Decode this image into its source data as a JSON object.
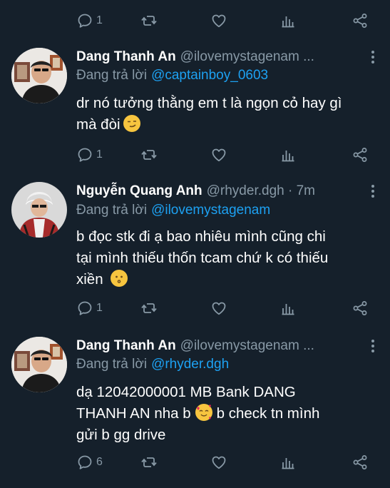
{
  "actions": {
    "top": {
      "reply_count": "1"
    }
  },
  "tweets": [
    {
      "author": "Dang Thanh An",
      "handle": "@ilovemystagenam ...",
      "replying_label": "Đang trả lời",
      "replying_to": "@captainboy_0603",
      "text_line1": "dr nó tưởng thằng em t là ngọn cỏ hay gì",
      "text_line2": "mà đòi",
      "emoji": "smirking-face",
      "reply_count": "1"
    },
    {
      "author": "Nguyễn Quang Anh",
      "handle": "@rhyder.dgh · 7m",
      "replying_label": "Đang trả lời",
      "replying_to": "@ilovemystagenam",
      "text_line1": "b đọc stk đi ạ bao nhiêu mình cũng chi",
      "text_line2": "tại mình thiếu thốn tcam chứ k có thiếu",
      "text_line3": "xiền",
      "emoji": "kissing-face",
      "reply_count": "1"
    },
    {
      "author": "Dang Thanh An",
      "handle": "@ilovemystagenam ...",
      "replying_label": "Đang trả lời",
      "replying_to": "@rhyder.dgh",
      "text_line1": "dạ 12042000001 MB Bank DANG",
      "text_line2a": "THANH AN nha b",
      "text_line2b": "b check tn mình",
      "text_line3": "gửi b gg drive",
      "emoji": "smiling-face-with-hearts",
      "reply_count": "6"
    }
  ],
  "colors": {
    "background": "#15202b",
    "secondary_text": "#8899a6",
    "mention": "#1da1f2",
    "primary_text": "#ffffff"
  }
}
